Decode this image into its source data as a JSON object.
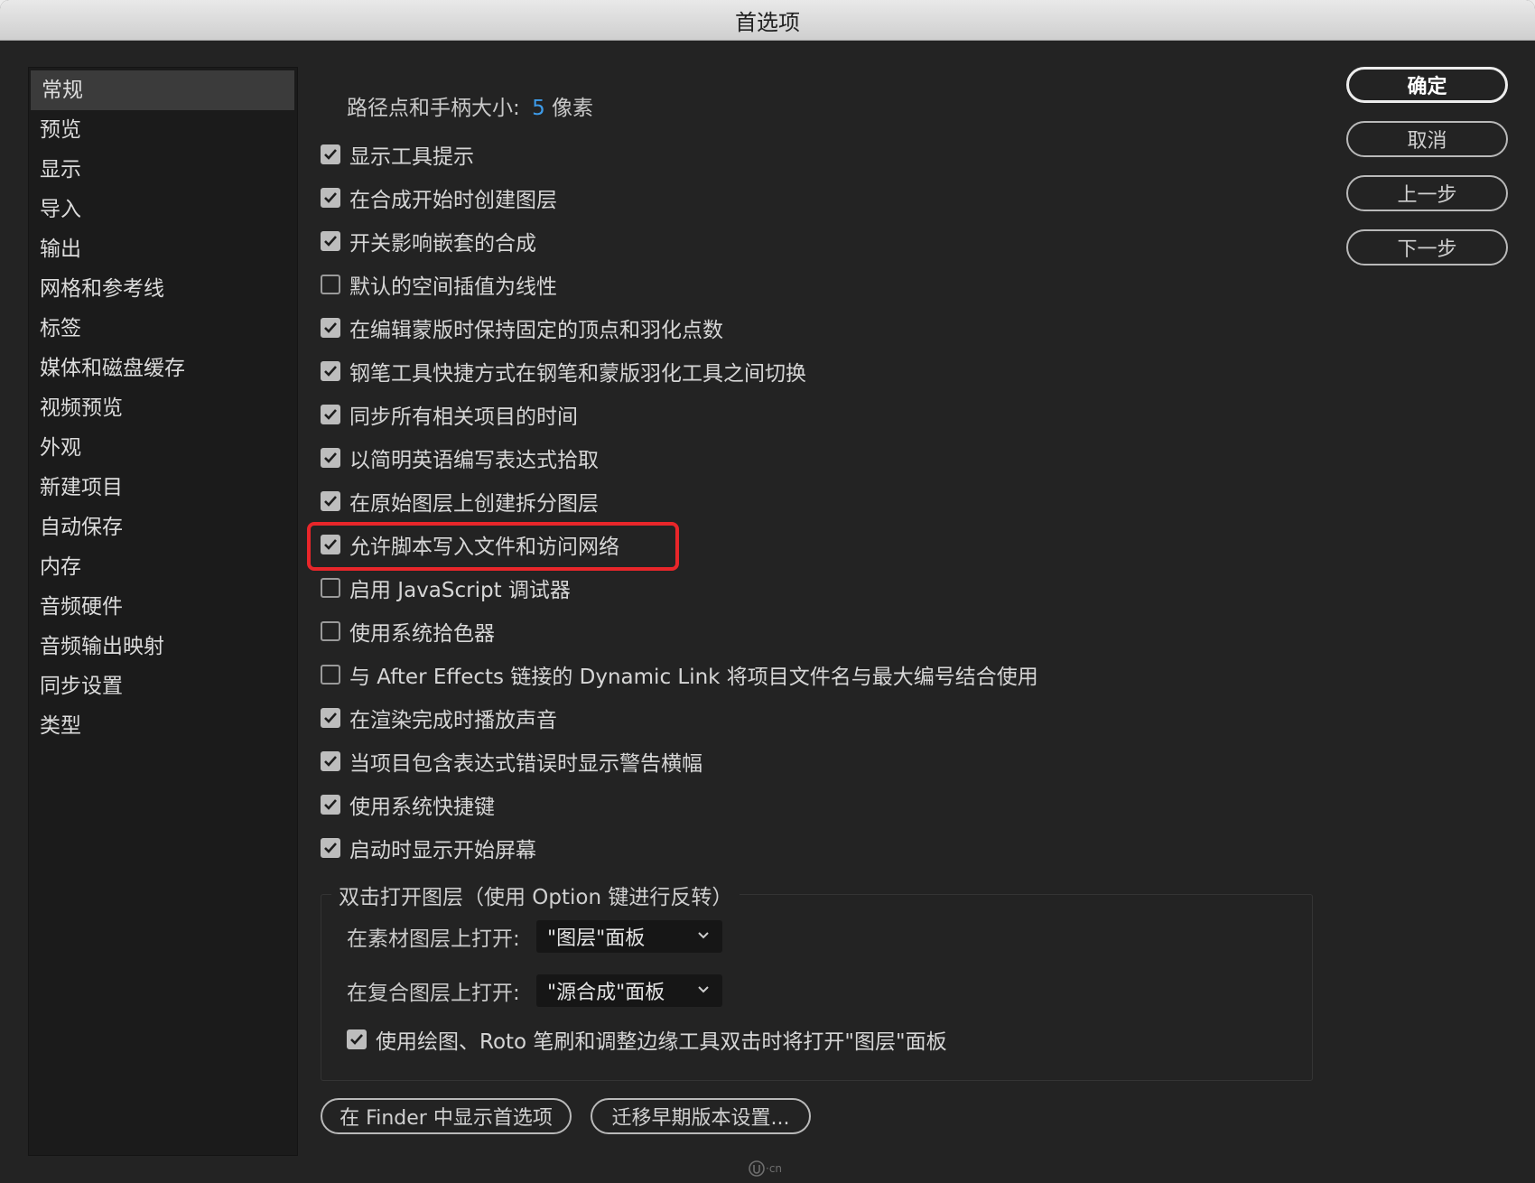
{
  "window": {
    "title": "首选项"
  },
  "sidebar": {
    "items": [
      {
        "label": "常规",
        "selected": true
      },
      {
        "label": "预览"
      },
      {
        "label": "显示"
      },
      {
        "label": "导入"
      },
      {
        "label": "输出"
      },
      {
        "label": "网格和参考线"
      },
      {
        "label": "标签"
      },
      {
        "label": "媒体和磁盘缓存"
      },
      {
        "label": "视频预览"
      },
      {
        "label": "外观"
      },
      {
        "label": "新建项目"
      },
      {
        "label": "自动保存"
      },
      {
        "label": "内存"
      },
      {
        "label": "音频硬件"
      },
      {
        "label": "音频输出映射"
      },
      {
        "label": "同步设置"
      },
      {
        "label": "类型"
      }
    ]
  },
  "general": {
    "path_point_label": "路径点和手柄大小:",
    "path_point_value": "5",
    "path_point_unit": "像素",
    "options": [
      {
        "label": "显示工具提示",
        "checked": true
      },
      {
        "label": "在合成开始时创建图层",
        "checked": true
      },
      {
        "label": "开关影响嵌套的合成",
        "checked": true
      },
      {
        "label": "默认的空间插值为线性",
        "checked": false
      },
      {
        "label": "在编辑蒙版时保持固定的顶点和羽化点数",
        "checked": true
      },
      {
        "label": "钢笔工具快捷方式在钢笔和蒙版羽化工具之间切换",
        "checked": true
      },
      {
        "label": "同步所有相关项目的时间",
        "checked": true
      },
      {
        "label": "以简明英语编写表达式拾取",
        "checked": true
      },
      {
        "label": "在原始图层上创建拆分图层",
        "checked": true
      },
      {
        "label": "允许脚本写入文件和访问网络",
        "checked": true
      },
      {
        "label": "启用 JavaScript 调试器",
        "checked": false
      },
      {
        "label": "使用系统拾色器",
        "checked": false
      },
      {
        "label": "与 After Effects 链接的 Dynamic Link 将项目文件名与最大编号结合使用",
        "checked": false
      },
      {
        "label": "在渲染完成时播放声音",
        "checked": true
      },
      {
        "label": "当项目包含表达式错误时显示警告横幅",
        "checked": true
      },
      {
        "label": "使用系统快捷键",
        "checked": true
      },
      {
        "label": "启动时显示开始屏幕",
        "checked": true
      }
    ],
    "double_click_group": {
      "title": "双击打开图层（使用 Option 键进行反转）",
      "footage_label": "在素材图层上打开:",
      "footage_value": "\"图层\"面板",
      "comp_label": "在复合图层上打开:",
      "comp_value": "\"源合成\"面板",
      "paint_option": {
        "label": "使用绘图、Roto 笔刷和调整边缘工具双击时将打开\"图层\"面板",
        "checked": true
      }
    },
    "buttons": {
      "reveal_finder": "在 Finder 中显示首选项",
      "migrate": "迁移早期版本设置..."
    }
  },
  "dialog_buttons": {
    "ok": "确定",
    "cancel": "取消",
    "previous": "上一步",
    "next": "下一步"
  },
  "watermark": {
    "text": "·cn"
  },
  "colors": {
    "window_bg": "#232323",
    "sidebar_bg": "#1b1b1b",
    "selected_bg": "#3b3b3b",
    "accent_value": "#3d9be9",
    "highlight_box": "#e8262a"
  }
}
